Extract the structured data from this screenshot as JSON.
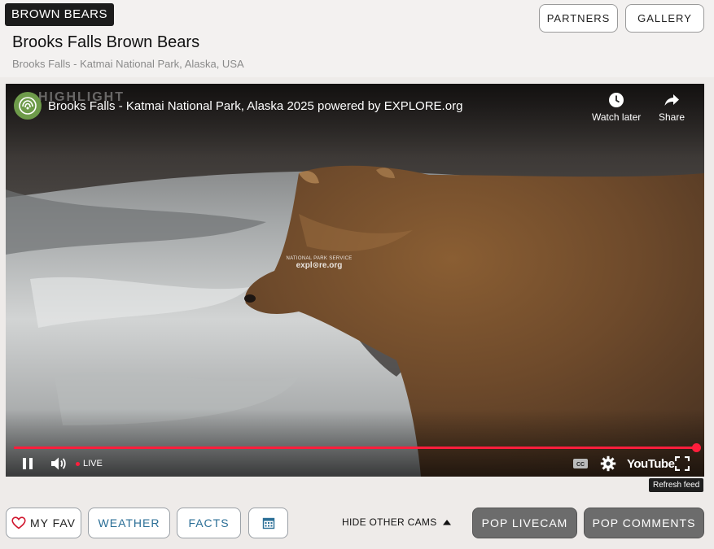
{
  "header": {
    "tag": "BROWN BEARS",
    "title": "Brooks Falls Brown Bears",
    "subtitle": "Brooks Falls - Katmai National Park, Alaska, USA",
    "buttons": {
      "partners": "PARTNERS",
      "gallery": "GALLERY"
    }
  },
  "player": {
    "highlight_text": "HIGHLIGHT",
    "video_title": "Brooks Falls - Katmai National Park, Alaska 2025 powered by EXPLORE.org",
    "watch_later": "Watch later",
    "share": "Share",
    "watermark_top": "NATIONAL PARK SERVICE",
    "watermark_bottom": "expl⊙re.org",
    "live_label": "LIVE",
    "youtube_label": "YouTube",
    "progress": 1.0,
    "refresh_tooltip": "Refresh feed",
    "icons": [
      "channel-logo-icon",
      "clock-icon",
      "share-icon",
      "pause-icon",
      "volume-icon",
      "cc-icon",
      "gear-icon",
      "fullscreen-icon"
    ]
  },
  "bottom_bar": {
    "my_fav": "MY FAV",
    "weather": "WEATHER",
    "facts": "FACTS",
    "hide_other_cams": "HIDE OTHER CAMS",
    "pop_livecam": "POP LIVECAM",
    "pop_comments": "POP COMMENTS",
    "icons": [
      "heart-icon",
      "calendar-icon",
      "caret-up-icon"
    ]
  },
  "colors": {
    "accent_red": "#ff1e3c",
    "link_blue": "#2a6e96",
    "dark_button": "#6c6c6c",
    "tag_bg": "#1c1c1c"
  }
}
